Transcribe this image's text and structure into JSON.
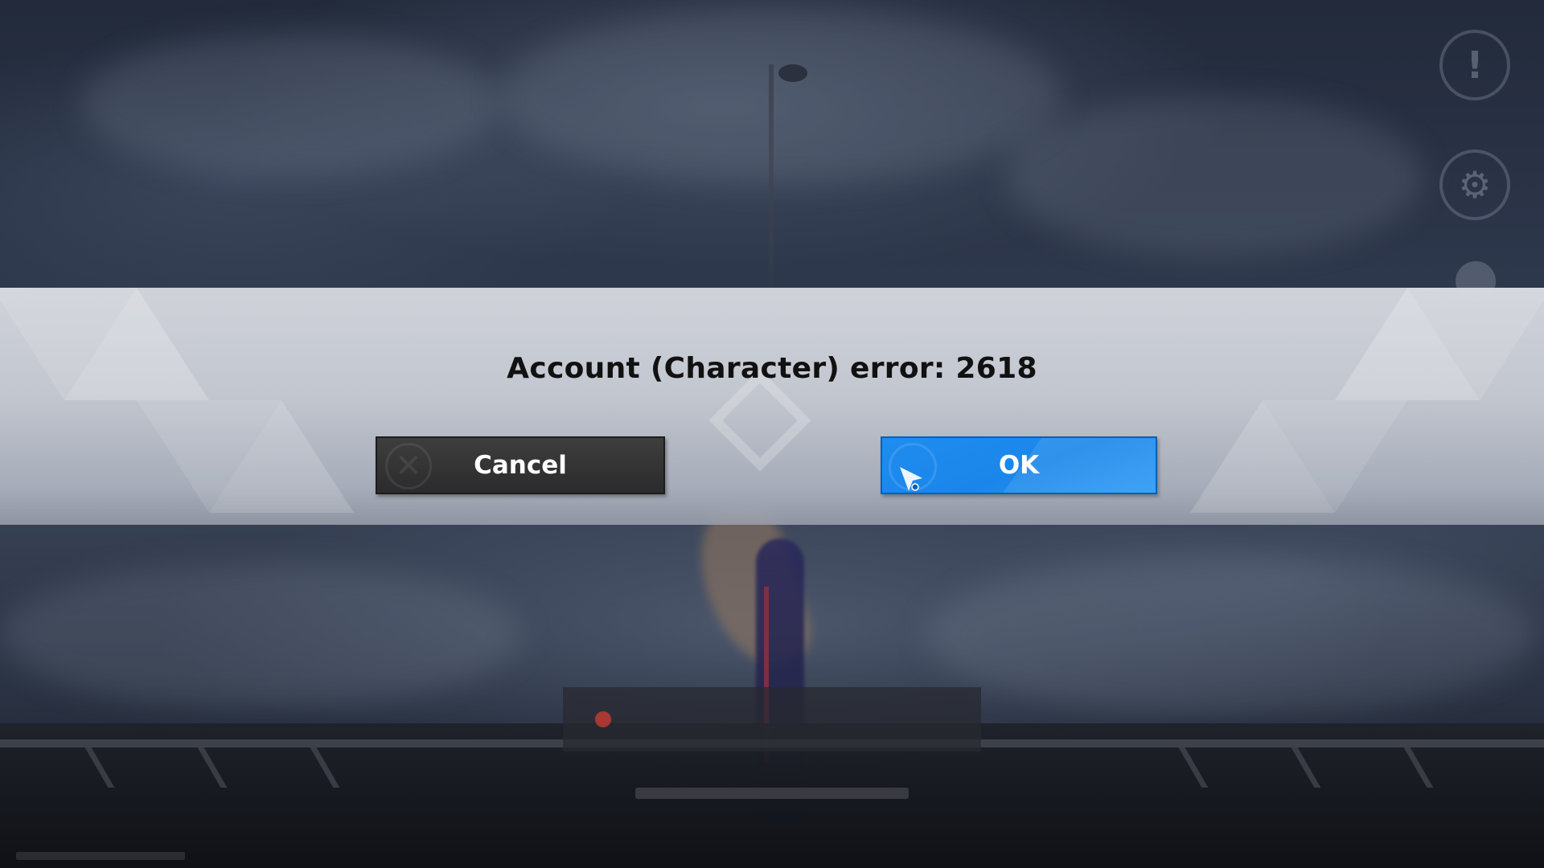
{
  "dialog": {
    "message": "Account (Character) error: 2618",
    "cancel_label": "Cancel",
    "ok_label": "OK"
  },
  "background": {
    "side_icons": [
      "notice-icon",
      "settings-icon"
    ]
  },
  "colors": {
    "ok_button": "#1a86ea",
    "cancel_button": "#333333",
    "dialog_band": "#cfd2d9",
    "message_text": "#111111"
  }
}
